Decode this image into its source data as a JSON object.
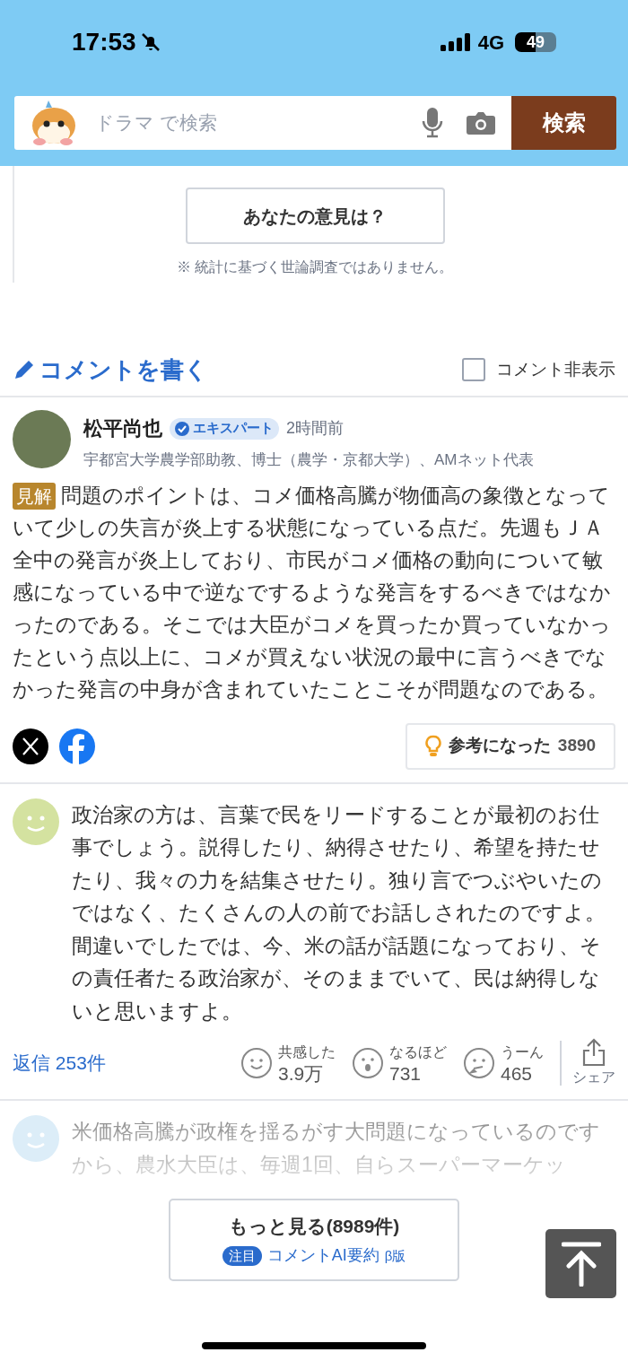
{
  "status_bar": {
    "time": "17:53",
    "silent": true,
    "network": "4G",
    "battery": "49"
  },
  "search": {
    "placeholder": "ドラマ で検索",
    "button": "検索"
  },
  "poll": {
    "button": "あなたの意見は？",
    "note": "※ 統計に基づく世論調査ではありません。"
  },
  "comment_toolbar": {
    "write": "コメントを書く",
    "hide_label": "コメント非表示",
    "hide_checked": false
  },
  "expert_comment": {
    "name": "松平尚也",
    "badge": "エキスパート",
    "time": "2時間前",
    "affiliation": "宇都宮大学農学部助教、博士（農学・京都大学）、AMネット代表",
    "tag": "見解",
    "body": "問題のポイントは、コメ価格高騰が物価高の象徴となっていて少しの失言が炎上する状態になっている点だ。先週もＪＡ全中の発言が炎上しており、市民がコメ価格の動向について敏感になっている中で逆なでするような発言をするべきではなかったのである。そこでは大臣がコメを買ったか買っていなかったという点以上に、コメが買えない状況の最中に言うべきでなかった発言の中身が含まれていたことこそが問題なのである。",
    "helpful_label": "参考になった",
    "helpful_count": "3890"
  },
  "comments": [
    {
      "kind": "full",
      "body": "政治家の方は、言葉で民をリードすることが最初のお仕事でしょう。説得したり、納得させたり、希望を持たせたり、我々の力を結集させたり。独り言でつぶやいたのではなく、たくさんの人の前でお話しされたのですよ。間違いでしたでは、今、米の話が話題になっており、その責任者たる政治家が、そのままでいて、民は納得しないと思いますよ。",
      "replies": "返信 253件",
      "reactions": [
        {
          "label": "共感した",
          "count": "3.9万"
        },
        {
          "label": "なるほど",
          "count": "731"
        },
        {
          "label": "うーん",
          "count": "465"
        }
      ],
      "share": "シェア"
    },
    {
      "kind": "faded",
      "body": "米価格高騰が政権を揺るがす大問題になっているのですから、農水大臣は、毎週1回、自らスーパーマーケッ"
    }
  ],
  "more_button": {
    "label": "もっと見る(8989件)",
    "tag": "注目",
    "link": "コメントAI要約",
    "beta": "β版"
  }
}
